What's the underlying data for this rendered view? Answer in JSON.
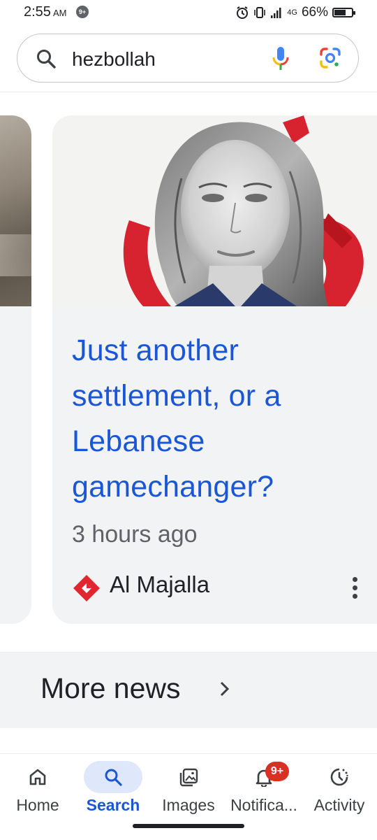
{
  "status_bar": {
    "time": "2:55",
    "ampm": "AM",
    "notification_badge": "9+",
    "network": "4G",
    "battery_percent": "66%",
    "battery_level": 0.66
  },
  "search": {
    "query": "hezbollah"
  },
  "news_card": {
    "title": "Just another settlement, or a Lebanese gamechanger?",
    "time": "3 hours ago",
    "source": "Al Majalla"
  },
  "more_news": {
    "label": "More news"
  },
  "bottom_nav": {
    "items": [
      {
        "label": "Home",
        "icon": "home-icon"
      },
      {
        "label": "Search",
        "icon": "search-icon",
        "active": true
      },
      {
        "label": "Images",
        "icon": "images-icon"
      },
      {
        "label": "Notifica...",
        "icon": "bell-icon",
        "badge": "9+"
      },
      {
        "label": "Activity",
        "icon": "activity-icon"
      }
    ]
  },
  "colors": {
    "link_blue": "#1a56d6",
    "card_bg": "#f1f3f4",
    "badge_red": "#d93025",
    "active_nav_bg": "#dfe8fa"
  }
}
